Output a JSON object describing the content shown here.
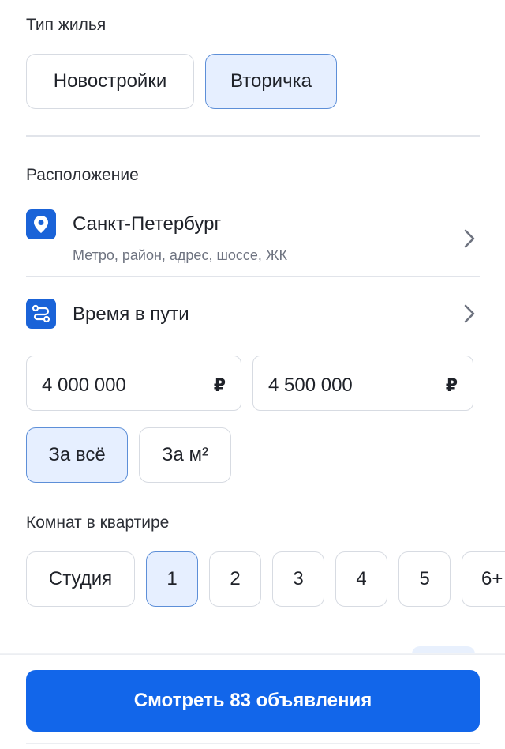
{
  "housing": {
    "label": "Тип жилья",
    "options": [
      {
        "label": "Новостройки",
        "active": false
      },
      {
        "label": "Вторичка",
        "active": true
      }
    ]
  },
  "location": {
    "label": "Расположение",
    "city": "Санкт-Петербург",
    "hint": "Метро, район, адрес, шоссе, ЖК",
    "icon": "location-pin-icon"
  },
  "commute": {
    "label": "Время в пути",
    "icon": "route-icon"
  },
  "price": {
    "from": "4 000 000",
    "to": "4 500 000",
    "currency": "₽"
  },
  "price_mode": {
    "options": [
      {
        "label": "За всё",
        "active": true
      },
      {
        "label": "За м²",
        "active": false
      }
    ]
  },
  "rooms": {
    "label": "Комнат в квартире",
    "options": [
      {
        "label": "Студия",
        "active": false
      },
      {
        "label": "1",
        "active": true
      },
      {
        "label": "2",
        "active": false
      },
      {
        "label": "3",
        "active": false
      },
      {
        "label": "4",
        "active": false
      },
      {
        "label": "5",
        "active": false
      },
      {
        "label": "6+",
        "active": false
      }
    ]
  },
  "cta": {
    "label": "Смотреть 83 объявления"
  },
  "colors": {
    "accent": "#1266ea",
    "active_chip_bg": "#e6efff",
    "active_chip_border": "#5d8fd8"
  }
}
